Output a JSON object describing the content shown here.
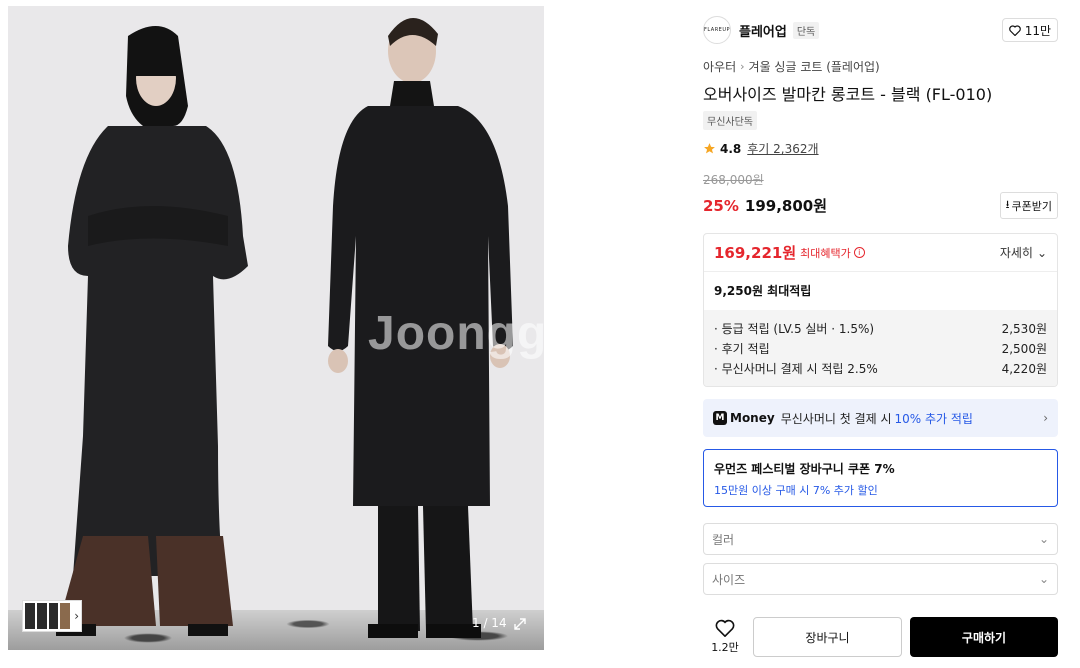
{
  "gallery": {
    "watermark": "Joonggonara",
    "counter": "1 / 14"
  },
  "brand": {
    "logo_text": "FLAREUP",
    "name": "플레어업",
    "badge": "단독",
    "like_count": "11만"
  },
  "breadcrumb": {
    "category": "아우터",
    "subcategory": "겨울 싱글 코트 (플레어업)"
  },
  "product": {
    "title": "오버사이즈 발마칸 롱코트 - 블랙 (FL-010)",
    "exclusive_tag": "무신사단독",
    "rating": "4.8",
    "reviews": "후기 2,362개",
    "original_price": "268,000원",
    "discount": "25%",
    "price": "199,800원",
    "coupon_label": "쿠폰받기"
  },
  "benefit": {
    "max_price": "169,221원",
    "max_label": "최대혜택가",
    "detail_label": "자세히",
    "points_total": "9,250원 최대적립",
    "points": [
      {
        "label": "· 등급 적립 (LV.5 실버 · 1.5%)",
        "value": "2,530원"
      },
      {
        "label": "· 후기 적립",
        "value": "2,500원"
      },
      {
        "label": "· 무신사머니 결제 시 적립 2.5%",
        "value": "4,220원"
      }
    ]
  },
  "money_banner": {
    "logo": "Money",
    "text": "무신사머니 첫 결제 시",
    "highlight": "10% 추가 적립"
  },
  "coupon": {
    "title": "우먼즈 페스티벌 장바구니 쿠폰 7%",
    "subtitle": "15만원 이상 구매 시 7% 추가 할인"
  },
  "options": {
    "color_placeholder": "컬러",
    "size_placeholder": "사이즈"
  },
  "actions": {
    "wish_count": "1.2만",
    "cart_label": "장바구니",
    "buy_label": "구매하기"
  }
}
